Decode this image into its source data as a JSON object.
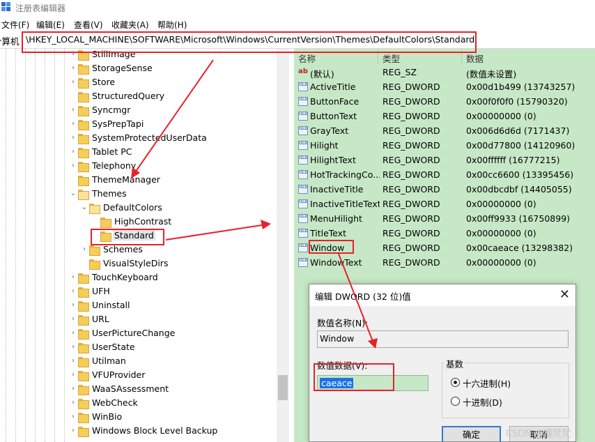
{
  "window": {
    "title": "注册表编辑器"
  },
  "menu": [
    {
      "label": "文件(F)"
    },
    {
      "label": "编辑(E)"
    },
    {
      "label": "查看(V)"
    },
    {
      "label": "收藏夹(A)"
    },
    {
      "label": "帮助(H)"
    }
  ],
  "address": {
    "prefix": "计算机",
    "path": "\\HKEY_LOCAL_MACHINE\\SOFTWARE\\Microsoft\\Windows\\CurrentVersion\\Themes\\DefaultColors\\Standard"
  },
  "tree": [
    {
      "label": "StillImage",
      "expand": "›",
      "level": 0
    },
    {
      "label": "StorageSense",
      "expand": "›",
      "level": 0
    },
    {
      "label": "Store",
      "expand": "›",
      "level": 0
    },
    {
      "label": "StructuredQuery",
      "expand": "",
      "level": 0
    },
    {
      "label": "Syncmgr",
      "expand": "›",
      "level": 0
    },
    {
      "label": "SysPrepTapi",
      "expand": "›",
      "level": 0
    },
    {
      "label": "SystemProtectedUserData",
      "expand": "›",
      "level": 0
    },
    {
      "label": "Tablet PC",
      "expand": "›",
      "level": 0
    },
    {
      "label": "Telephony",
      "expand": "›",
      "level": 0
    },
    {
      "label": "ThemeManager",
      "expand": "",
      "level": 0
    },
    {
      "label": "Themes",
      "expand": "⌄",
      "level": 0,
      "open": true
    },
    {
      "label": "DefaultColors",
      "expand": "⌄",
      "level": 1,
      "open": true
    },
    {
      "label": "HighContrast",
      "expand": "",
      "level": 2
    },
    {
      "label": "Standard",
      "expand": "",
      "level": 2,
      "selected": true
    },
    {
      "label": "Schemes",
      "expand": "›",
      "level": 1
    },
    {
      "label": "VisualStyleDirs",
      "expand": "",
      "level": 1
    },
    {
      "label": "TouchKeyboard",
      "expand": "›",
      "level": 0
    },
    {
      "label": "UFH",
      "expand": "›",
      "level": 0
    },
    {
      "label": "Uninstall",
      "expand": "›",
      "level": 0
    },
    {
      "label": "URL",
      "expand": "›",
      "level": 0
    },
    {
      "label": "UserPictureChange",
      "expand": "›",
      "level": 0
    },
    {
      "label": "UserState",
      "expand": "›",
      "level": 0
    },
    {
      "label": "Utilman",
      "expand": "›",
      "level": 0
    },
    {
      "label": "VFUProvider",
      "expand": "›",
      "level": 0
    },
    {
      "label": "WaaSAssessment",
      "expand": "›",
      "level": 0
    },
    {
      "label": "WebCheck",
      "expand": "›",
      "level": 0
    },
    {
      "label": "WinBio",
      "expand": "›",
      "level": 0
    },
    {
      "label": "Windows Block Level Backup",
      "expand": "›",
      "level": 0
    }
  ],
  "list": {
    "columns": {
      "name": "名称",
      "type": "类型",
      "data": "数据"
    },
    "rows": [
      {
        "icon": "string-value-icon",
        "name": "(默认)",
        "type": "REG_SZ",
        "data": "(数值未设置)"
      },
      {
        "icon": "dword-value-icon",
        "name": "ActiveTitle",
        "type": "REG_DWORD",
        "data": "0x00d1b499 (13743257)"
      },
      {
        "icon": "dword-value-icon",
        "name": "ButtonFace",
        "type": "REG_DWORD",
        "data": "0x00f0f0f0 (15790320)"
      },
      {
        "icon": "dword-value-icon",
        "name": "ButtonText",
        "type": "REG_DWORD",
        "data": "0x00000000 (0)"
      },
      {
        "icon": "dword-value-icon",
        "name": "GrayText",
        "type": "REG_DWORD",
        "data": "0x006d6d6d (7171437)"
      },
      {
        "icon": "dword-value-icon",
        "name": "Hilight",
        "type": "REG_DWORD",
        "data": "0x00d77800 (14120960)"
      },
      {
        "icon": "dword-value-icon",
        "name": "HilightText",
        "type": "REG_DWORD",
        "data": "0x00ffffff (16777215)"
      },
      {
        "icon": "dword-value-icon",
        "name": "HotTrackingCo...",
        "type": "REG_DWORD",
        "data": "0x00cc6600 (13395456)"
      },
      {
        "icon": "dword-value-icon",
        "name": "InactiveTitle",
        "type": "REG_DWORD",
        "data": "0x00dbcdbf (14405055)"
      },
      {
        "icon": "dword-value-icon",
        "name": "InactiveTitleText",
        "type": "REG_DWORD",
        "data": "0x00000000 (0)"
      },
      {
        "icon": "dword-value-icon",
        "name": "MenuHilight",
        "type": "REG_DWORD",
        "data": "0x00ff9933 (16750899)"
      },
      {
        "icon": "dword-value-icon",
        "name": "TitleText",
        "type": "REG_DWORD",
        "data": "0x00000000 (0)"
      },
      {
        "icon": "dword-value-icon",
        "name": "Window",
        "type": "REG_DWORD",
        "data": "0x00caeace (13298382)"
      },
      {
        "icon": "dword-value-icon",
        "name": "WindowText",
        "type": "REG_DWORD",
        "data": "0x00000000 (0)"
      }
    ]
  },
  "dialog": {
    "title": "编辑 DWORD (32 位)值",
    "name_label": "数值名称(N):",
    "name_value": "Window",
    "data_label": "数值数据(V):",
    "data_value": "caeace",
    "base_label": "基数",
    "hex_label": "十六进制(H)",
    "dec_label": "十进制(D)",
    "ok_label": "确定",
    "cancel_label": "取消"
  },
  "watermark": "CSDN @槿梵梵",
  "colors": {
    "list_background": "#c7e8c7",
    "annotation_red": "#e8202a",
    "selection_blue": "#1a73e8"
  }
}
